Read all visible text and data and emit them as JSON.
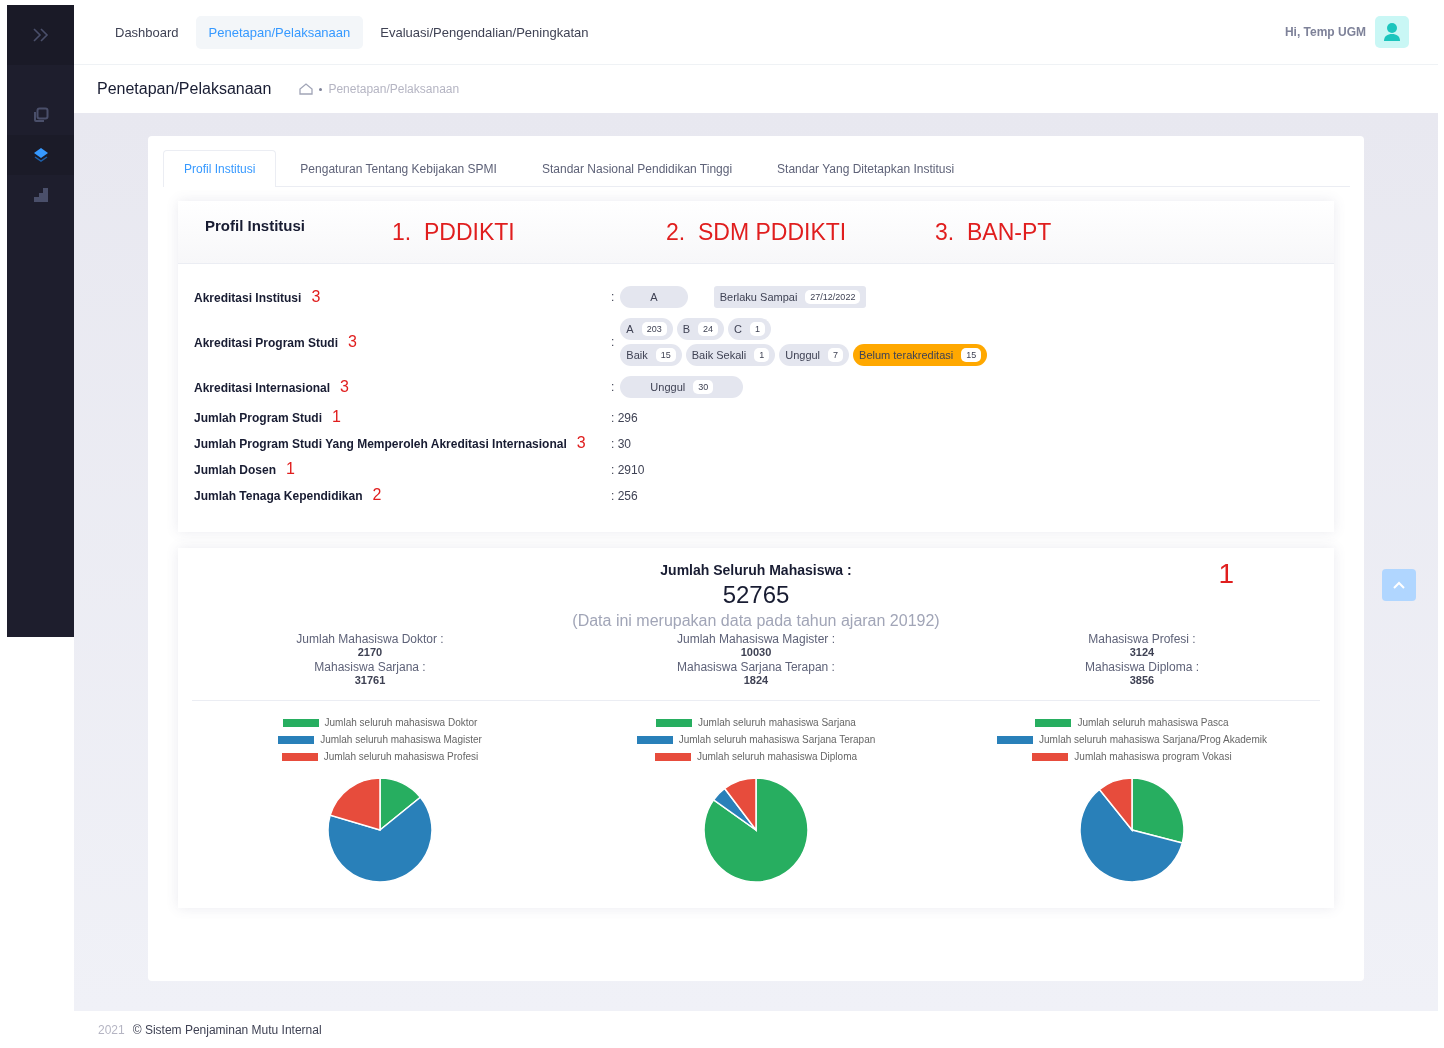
{
  "sidebar": {
    "items": [
      {
        "kind": "copy",
        "selected": false
      },
      {
        "kind": "layers",
        "selected": true
      },
      {
        "kind": "chart",
        "selected": false
      }
    ]
  },
  "nav": {
    "tabs": [
      {
        "label": "Dashboard",
        "selected": false
      },
      {
        "label": "Penetapan/Pelaksanaan",
        "selected": true
      },
      {
        "label": "Evaluasi/Pengendalian/Peningkatan",
        "selected": false
      }
    ],
    "greeting": "Hi, Temp UGM"
  },
  "page_header": {
    "title": "Penetapan/Pelaksanaan",
    "breadcrumb": "Penetapan/Pelaksanaan"
  },
  "tabs": [
    {
      "label": "Profil Institusi",
      "selected": true
    },
    {
      "label": "Pengaturan Tentang Kebijakan SPMI",
      "selected": false
    },
    {
      "label": "Standar Nasional Pendidikan Tinggi",
      "selected": false
    },
    {
      "label": "Standar Yang Ditetapkan Institusi",
      "selected": false
    }
  ],
  "profile": {
    "title": "Profil Institusi",
    "annotations": [
      "1.  PDDIKTI",
      "2.  SDM PDDIKTI",
      "3.  BAN-PT"
    ],
    "rows": [
      {
        "kind": "chips",
        "label": "Akreditasi Institusi",
        "note": "3",
        "separator": ":",
        "lines": [
          [
            {
              "label": "A",
              "kind": "grade",
              "color": "#e4e6ef"
            },
            {
              "label": "Berlaku Sampai",
              "count": "27/12/2022",
              "kind": "tag",
              "color": "#e4e6ef"
            }
          ]
        ]
      },
      {
        "kind": "chips",
        "label": "Akreditasi Program Studi",
        "note": "3",
        "separator": ":",
        "lines": [
          [
            {
              "label": "A",
              "count": "203",
              "kind": "chip",
              "color": "#e4e6ef"
            },
            {
              "label": "B",
              "count": "24",
              "kind": "chip",
              "color": "#e4e6ef"
            },
            {
              "label": "C",
              "count": "1",
              "kind": "chip",
              "color": "#e4e6ef"
            }
          ],
          [
            {
              "label": "Baik",
              "count": "15",
              "kind": "chip",
              "color": "#e4e6ef"
            },
            {
              "label": "Baik Sekali",
              "count": "1",
              "kind": "chip",
              "color": "#e4e6ef"
            },
            {
              "label": "Unggul",
              "count": "7",
              "kind": "chip",
              "color": "#e4e6ef"
            },
            {
              "label": "Belum terakreditasi",
              "count": "15",
              "kind": "chip",
              "color": "#ffa800"
            }
          ]
        ]
      },
      {
        "kind": "chips",
        "label": "Akreditasi Internasional",
        "note": "3",
        "separator": ":",
        "lines": [
          [
            {
              "label": "Unggul",
              "count": "30",
              "kind": "grade",
              "color": "#e4e6ef"
            }
          ]
        ]
      },
      {
        "kind": "text",
        "label": "Jumlah Program Studi",
        "note": "1",
        "value": ": 296"
      },
      {
        "kind": "text",
        "label": "Jumlah Program Studi Yang Memperoleh Akreditasi Internasional",
        "note": "3",
        "value": ": 30"
      },
      {
        "kind": "text",
        "label": "Jumlah Dosen",
        "note": "1",
        "value": ": 2910"
      },
      {
        "kind": "text",
        "label": "Jumlah Tenaga Kependidikan",
        "note": "2",
        "value": ": 256"
      }
    ]
  },
  "students": {
    "title": "Jumlah Seluruh Mahasiswa :",
    "total": "52765",
    "caption": "(Data ini merupakan data pada tahun ajaran 20192)",
    "note": "1",
    "columns": [
      [
        {
          "label": "Jumlah Mahasiswa Doktor :",
          "value": "2170"
        },
        {
          "label": "Mahasiswa Sarjana :",
          "value": "31761"
        }
      ],
      [
        {
          "label": "Jumlah Mahasiswa Magister :",
          "value": "10030"
        },
        {
          "label": "Mahasiswa Sarjana Terapan :",
          "value": "1824"
        }
      ],
      [
        {
          "label": "Mahasiswa Profesi :",
          "value": "3124"
        },
        {
          "label": "Mahasiswa Diploma :",
          "value": "3856"
        }
      ]
    ],
    "charts": [
      {
        "chart_data": {
          "type": "pie",
          "categories": [
            "Jumlah seluruh mahasiswa Doktor",
            "Jumlah seluruh mahasiswa Magister",
            "Jumlah seluruh mahasiswa Profesi"
          ],
          "values": [
            14.16,
            65.45,
            20.39
          ],
          "legend": "top",
          "colors": [
            "#27ae60",
            "#2980b9",
            "#e74c3c"
          ]
        }
      },
      {
        "chart_data": {
          "type": "pie",
          "categories": [
            "Jumlah seluruh mahasiswa Sarjana",
            "Jumlah seluruh mahasiswa Sarjana Terapan",
            "Jumlah seluruh mahasiswa Diploma"
          ],
          "values": [
            84.83,
            4.87,
            10.3
          ],
          "legend": "top",
          "colors": [
            "#27ae60",
            "#2980b9",
            "#e74c3c"
          ]
        }
      },
      {
        "chart_data": {
          "type": "pie",
          "categories": [
            "Jumlah seluruh mahasiswa Pasca",
            "Jumlah seluruh mahasiswa Sarjana/Prog Akademik",
            "Jumlah mahasiswa program Vokasi"
          ],
          "values": [
            29.04,
            60.19,
            10.77
          ],
          "legend": "top",
          "colors": [
            "#27ae60",
            "#2980b9",
            "#e74c3c"
          ]
        }
      }
    ]
  },
  "footer": {
    "year": "2021",
    "text": "© Sistem Penjaminan Mutu Internal"
  }
}
